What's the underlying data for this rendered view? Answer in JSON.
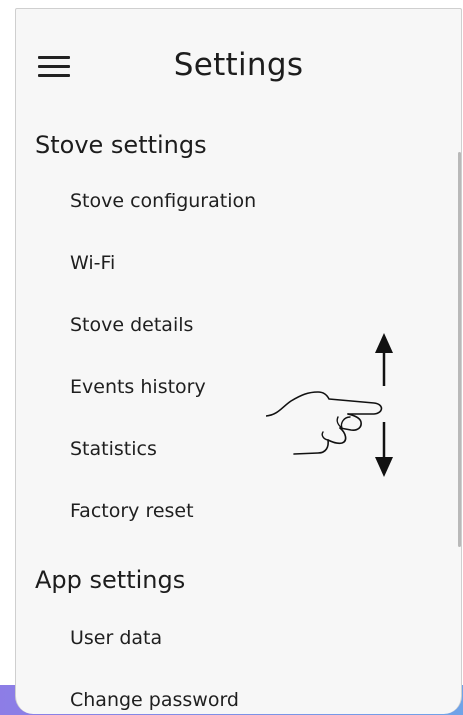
{
  "header": {
    "title": "Settings",
    "menu_icon": "hamburger-menu-icon"
  },
  "sections": [
    {
      "title": "Stove settings",
      "items": [
        {
          "label": "Stove configuration"
        },
        {
          "label": "Wi-Fi"
        },
        {
          "label": "Stove details"
        },
        {
          "label": "Events history"
        },
        {
          "label": "Statistics"
        },
        {
          "label": "Factory reset"
        }
      ]
    },
    {
      "title": "App settings",
      "items": [
        {
          "label": "User data"
        },
        {
          "label": "Change password"
        }
      ]
    }
  ],
  "overlay": {
    "gesture_icon": "swipe-up-down-hand-icon"
  },
  "colors": {
    "background": "#f7f7f7",
    "text": "#1d1d1d",
    "accent": "#8d7de6"
  }
}
